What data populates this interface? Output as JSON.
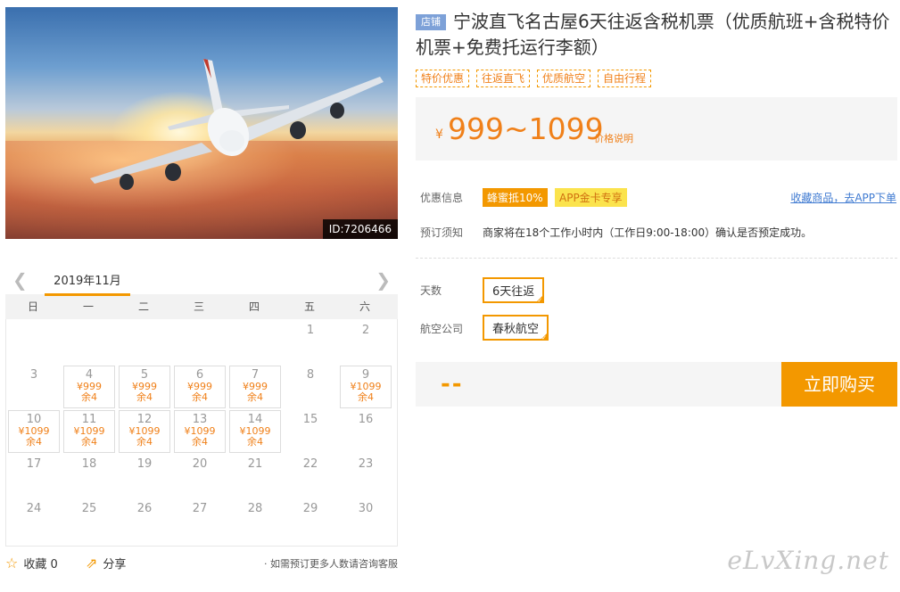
{
  "hero": {
    "id_tag": "ID:7206466"
  },
  "calendar": {
    "month": "2019年11月",
    "weekdays": [
      "日",
      "一",
      "二",
      "三",
      "四",
      "五",
      "六"
    ],
    "weeks": [
      [
        {
          "d": ""
        },
        {
          "d": ""
        },
        {
          "d": ""
        },
        {
          "d": ""
        },
        {
          "d": ""
        },
        {
          "d": "1"
        },
        {
          "d": "2"
        }
      ],
      [
        {
          "d": "3"
        },
        {
          "d": "4",
          "p": "¥999",
          "r": "余4"
        },
        {
          "d": "5",
          "p": "¥999",
          "r": "余4"
        },
        {
          "d": "6",
          "p": "¥999",
          "r": "余4"
        },
        {
          "d": "7",
          "p": "¥999",
          "r": "余4"
        },
        {
          "d": "8"
        },
        {
          "d": "9",
          "p": "¥1099",
          "r": "余4"
        }
      ],
      [
        {
          "d": "10",
          "p": "¥1099",
          "r": "余4"
        },
        {
          "d": "11",
          "p": "¥1099",
          "r": "余4"
        },
        {
          "d": "12",
          "p": "¥1099",
          "r": "余4"
        },
        {
          "d": "13",
          "p": "¥1099",
          "r": "余4"
        },
        {
          "d": "14",
          "p": "¥1099",
          "r": "余4"
        },
        {
          "d": "15"
        },
        {
          "d": "16"
        }
      ],
      [
        {
          "d": "17"
        },
        {
          "d": "18"
        },
        {
          "d": "19"
        },
        {
          "d": "20"
        },
        {
          "d": "21"
        },
        {
          "d": "22"
        },
        {
          "d": "23"
        }
      ],
      [
        {
          "d": "24"
        },
        {
          "d": "25"
        },
        {
          "d": "26"
        },
        {
          "d": "27"
        },
        {
          "d": "28"
        },
        {
          "d": "29"
        },
        {
          "d": "30"
        }
      ]
    ]
  },
  "bottom": {
    "fav_label": "收藏",
    "fav_count": "0",
    "share_label": "分享",
    "note": "· 如需预订更多人数请咨询客服"
  },
  "product": {
    "badge": "店铺",
    "title": "宁波直飞名古屋6天往返含税机票（优质航班+含税特价机票+免费托运行李额）",
    "tags": [
      "特价优惠",
      "往返直飞",
      "优质航空",
      "自由行程"
    ]
  },
  "price": {
    "currency": "¥",
    "range": "999~1099",
    "explain_link": "价格说明"
  },
  "promo": {
    "label": "优惠信息",
    "badge1": "蜂蜜抵10%",
    "badge2": "APP金卡专享",
    "app_link": "收藏商品，去APP下单"
  },
  "booking": {
    "label": "预订须知",
    "text": "商家将在18个工作小时内（工作日9:00-18:00）确认是否预定成功。"
  },
  "options": {
    "days_label": "天数",
    "days_value": "6天往返",
    "airline_label": "航空公司",
    "airline_value": "春秋航空"
  },
  "buy": {
    "price_placeholder": "--",
    "button": "立即购买"
  },
  "watermark": "eLvXing.net",
  "colors": {
    "accent": "#f39800",
    "price": "#f08019",
    "link": "#3f7ad1",
    "badge": "#7da1d8"
  }
}
